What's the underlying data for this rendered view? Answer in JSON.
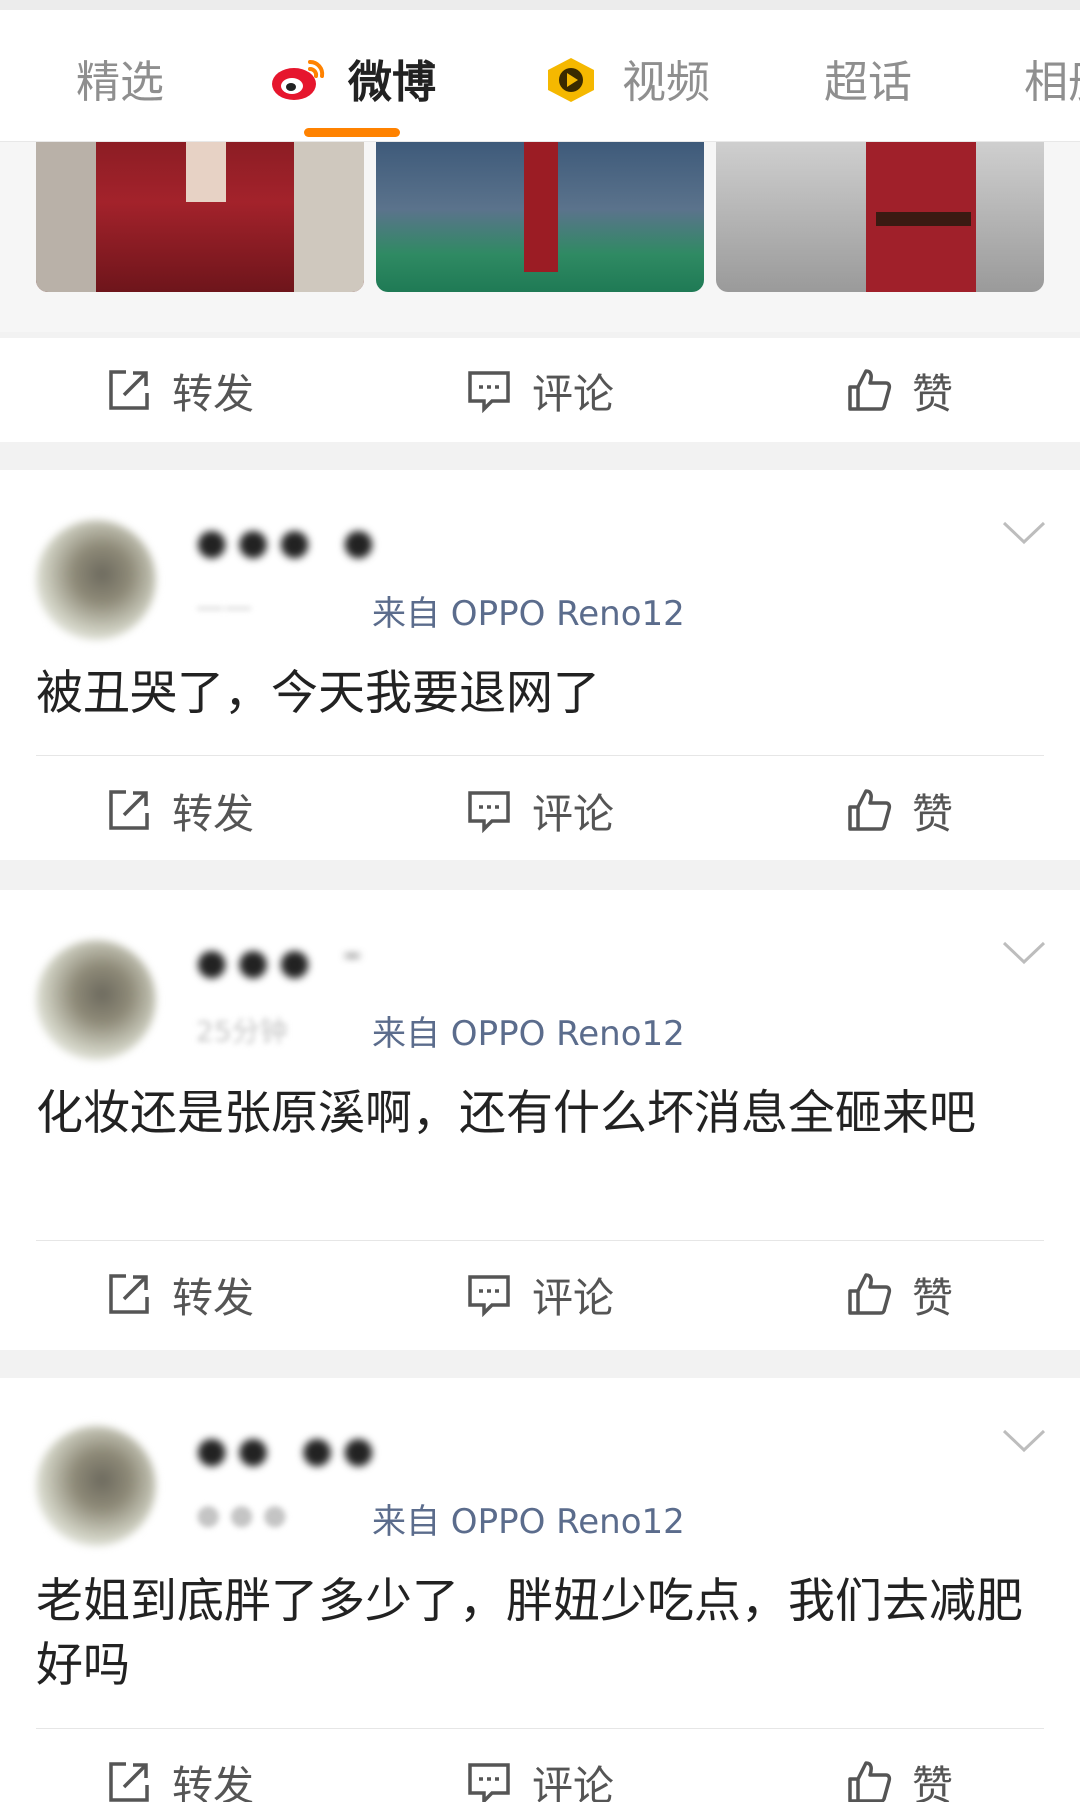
{
  "tabs": [
    {
      "label": "精选"
    },
    {
      "label": "微博"
    },
    {
      "label": "视频"
    },
    {
      "label": "超话"
    },
    {
      "label": "相册"
    }
  ],
  "actions": {
    "repost": "转发",
    "comment": "评论",
    "like": "赞"
  },
  "posts": [
    {
      "user_name": "●●● ●",
      "meta_blur": "——",
      "device": "来自 OPPO Reno12",
      "text": "被丑哭了，今天我要退网了"
    },
    {
      "user_name": "●●● ⁻",
      "meta_blur": "25分钟",
      "device": "来自 OPPO Reno12",
      "text": "化妆还是张原溪啊，还有什么坏消息全砸来吧"
    },
    {
      "user_name": "●● ●●",
      "meta_blur": "● ● ●",
      "device": "来自 OPPO Reno12",
      "text": "老姐到底胖了多少了，胖妞少吃点，我们去减肥好吗"
    }
  ],
  "colors": {
    "accent": "#ff8200",
    "device": "#5b6c8c"
  }
}
